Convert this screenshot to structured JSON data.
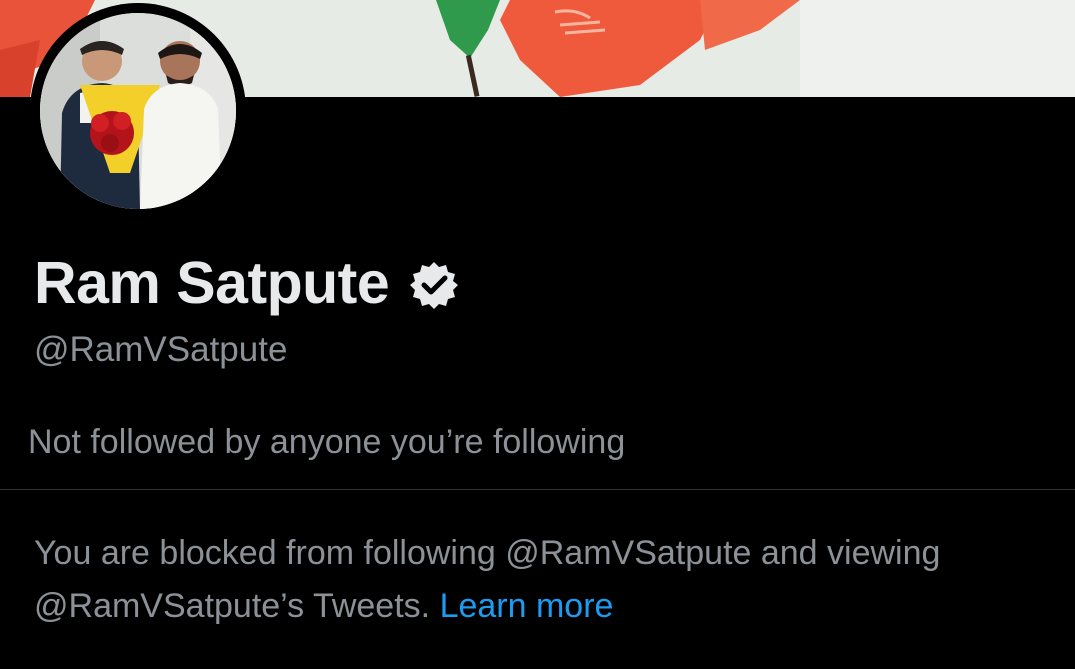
{
  "profile": {
    "display_name": "Ram Satpute",
    "handle": "@RamVSatpute",
    "verified": true,
    "followers_note": "Not followed by anyone you’re following"
  },
  "blocked": {
    "message": "You are blocked from following @RamVSatpute and viewing @RamVSatpute’s Tweets.",
    "learn_more_label": "Learn more"
  },
  "icons": {
    "verified": "verified-badge-icon"
  },
  "colors": {
    "background": "#000000",
    "primary_text": "#e7e9ea",
    "secondary_text": "#8b9197",
    "link": "#1d9bf0",
    "divider": "#2f3336"
  }
}
